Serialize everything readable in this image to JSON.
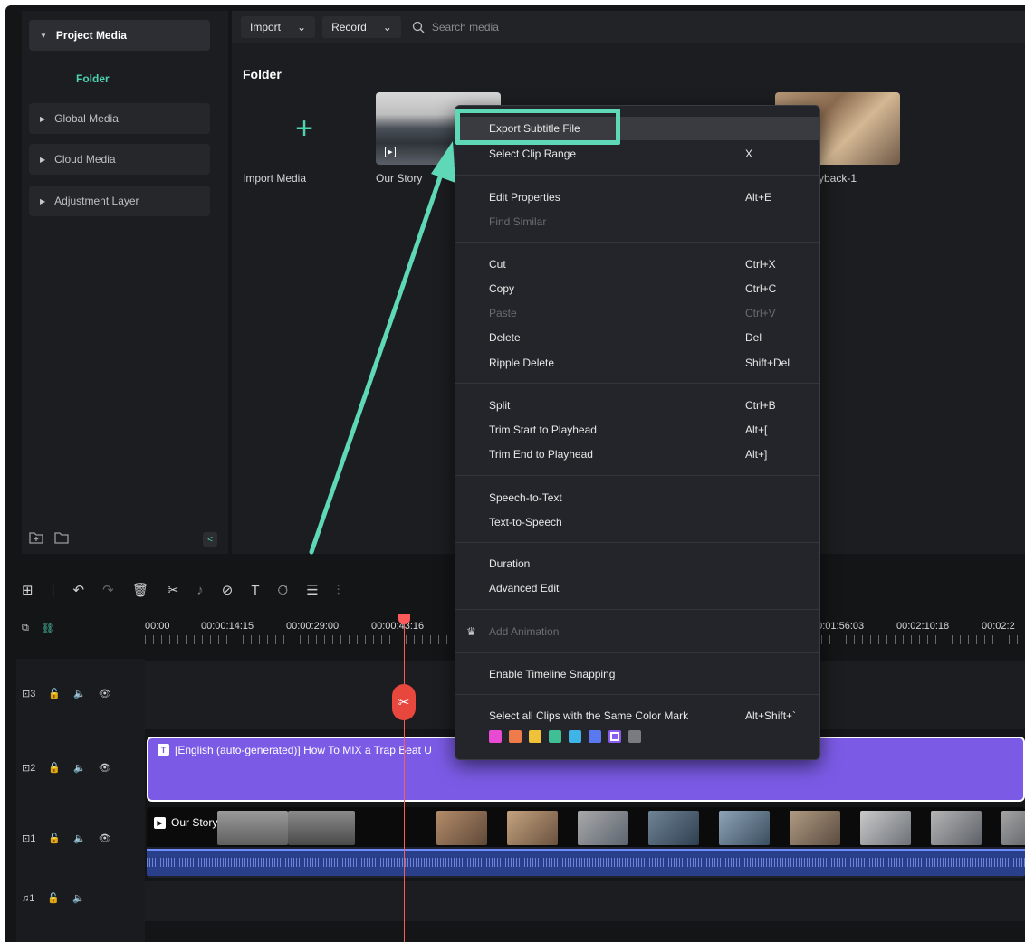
{
  "left_panel": {
    "project_media": "Project Media",
    "folder": "Folder",
    "global_media": "Global Media",
    "cloud_media": "Cloud Media",
    "adjustment_layer": "Adjustment Layer"
  },
  "toolbar": {
    "import": "Import",
    "record": "Record",
    "search_placeholder": "Search media"
  },
  "media": {
    "folder_title": "Folder",
    "import_media": "Import Media",
    "clip1": "Our Story",
    "clip2": "yback-1"
  },
  "context_menu": {
    "export_subtitle": "Export Subtitle File",
    "select_clip_range": "Select Clip Range",
    "select_clip_range_sc": "X",
    "edit_properties": "Edit Properties",
    "edit_properties_sc": "Alt+E",
    "find_similar": "Find Similar",
    "cut": "Cut",
    "cut_sc": "Ctrl+X",
    "copy": "Copy",
    "copy_sc": "Ctrl+C",
    "paste": "Paste",
    "paste_sc": "Ctrl+V",
    "delete": "Delete",
    "delete_sc": "Del",
    "ripple_delete": "Ripple Delete",
    "ripple_delete_sc": "Shift+Del",
    "split": "Split",
    "split_sc": "Ctrl+B",
    "trim_start": "Trim Start to Playhead",
    "trim_start_sc": "Alt+[",
    "trim_end": "Trim End to Playhead",
    "trim_end_sc": "Alt+]",
    "speech_to_text": "Speech-to-Text",
    "text_to_speech": "Text-to-Speech",
    "duration": "Duration",
    "advanced_edit": "Advanced Edit",
    "add_animation": "Add Animation",
    "enable_snapping": "Enable Timeline Snapping",
    "select_same_color": "Select all Clips with the Same Color Mark",
    "select_same_color_sc": "Alt+Shift+`",
    "swatch_colors": [
      "#e94ad4",
      "#f07b4a",
      "#f0c23a",
      "#3fbf93",
      "#3fb4e8",
      "#5a78f0",
      "#8a5cf0",
      "#7a7b80"
    ]
  },
  "timeline": {
    "ruler": [
      "00:00",
      "00:00:14:15",
      "00:00:29:00",
      "00:00:43:16",
      "00:01:56:03",
      "00:02:10:18",
      "00:02:2"
    ],
    "track_labels": [
      "3",
      "2",
      "1",
      "1"
    ],
    "subtitle_clip": "[English (auto-generated)] How To MIX a Trap Beat U",
    "video_clip": "Our Story"
  },
  "colors": {
    "accent": "#4fd1b3",
    "highlight_box": "#5fd8b8",
    "subtitle_clip": "#7b5be6",
    "playhead": "#ff5a5a"
  }
}
